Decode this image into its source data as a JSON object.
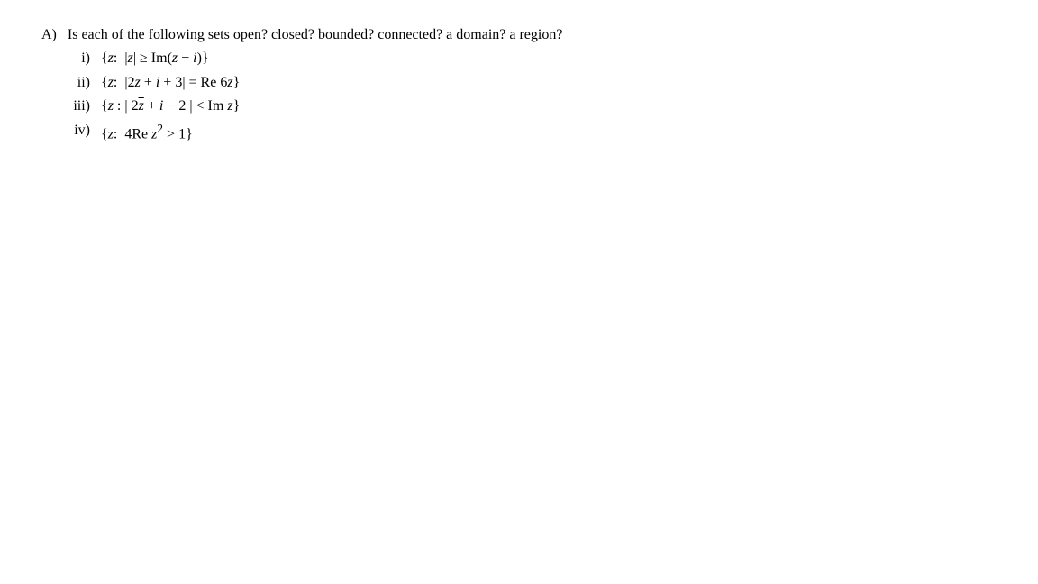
{
  "question": {
    "label": "A)",
    "text": "Is each of the following sets open?  closed?  bounded?  connected?  a domain?  a region?"
  },
  "items": [
    {
      "roman": "i)",
      "expr_html": "{<span class=\"italic\">z</span>:&nbsp; |<span class=\"italic\">z</span>| ≥  Im(<span class=\"italic\">z</span> − <span class=\"italic\">i</span>)}"
    },
    {
      "roman": "ii)",
      "expr_html": "{<span class=\"italic\">z</span>:&nbsp; |2<span class=\"italic\">z</span> + <span class=\"italic\">i</span> + 3|  =  Re 6<span class=\"italic\">z</span>}"
    },
    {
      "roman": "iii)",
      "expr_html": "{<span class=\"italic\">z</span> : | 2<span class=\"italic overline\">z</span> + <span class=\"italic\">i</span> − 2 | &lt; Im <span class=\"italic\">z</span>}"
    },
    {
      "roman": "iv)",
      "expr_html": "{<span class=\"italic\">z</span>:&nbsp; 4Re <span class=\"italic\">z</span><sup>2</sup>  &gt; 1}"
    }
  ]
}
